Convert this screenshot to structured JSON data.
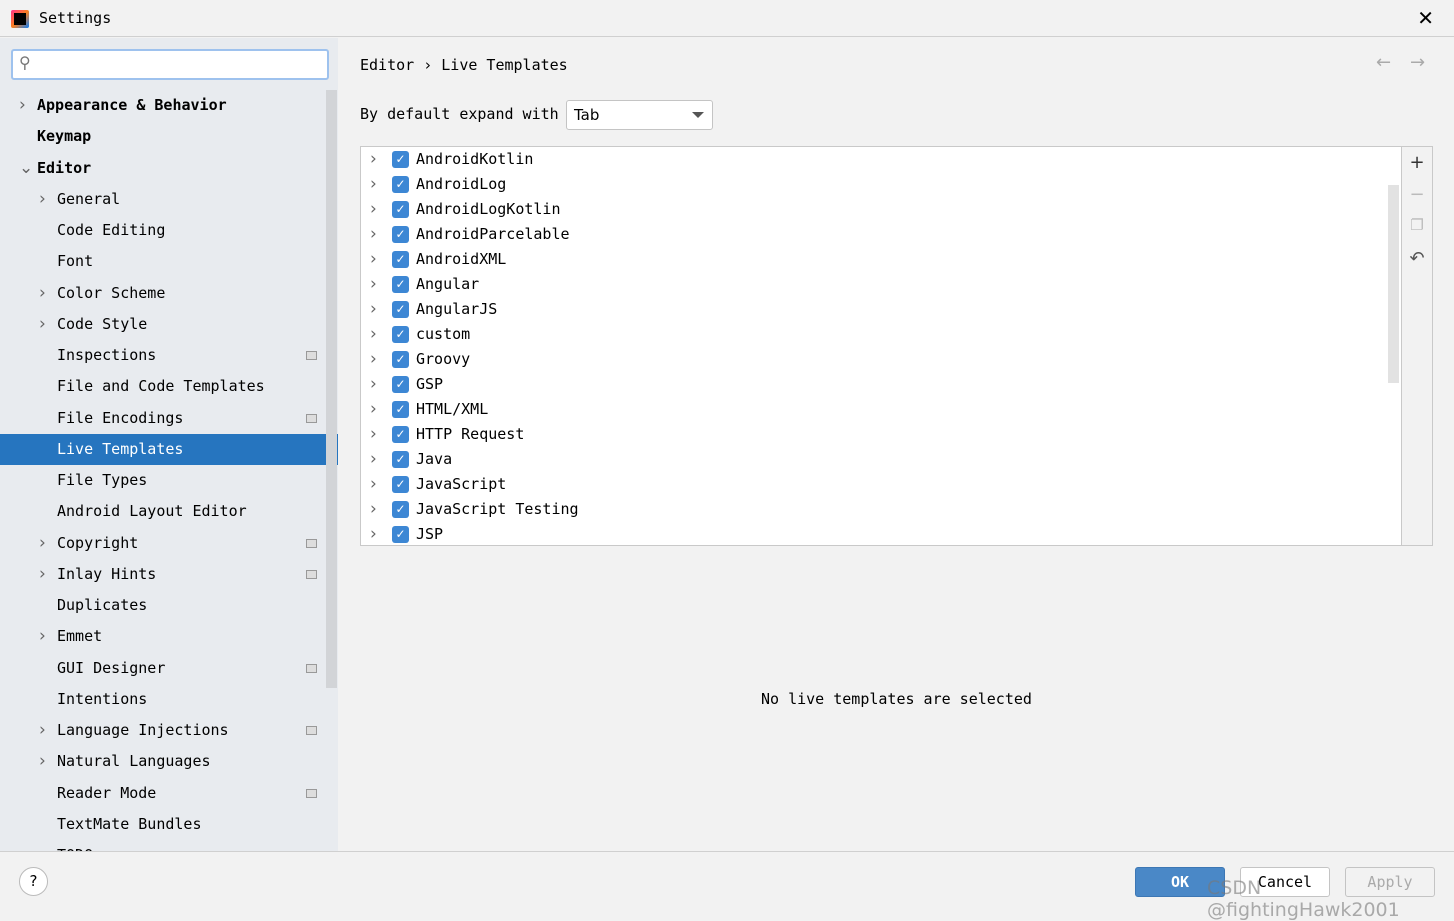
{
  "window": {
    "title": "Settings",
    "close_icon": "close-icon"
  },
  "search": {
    "placeholder": "",
    "value": ""
  },
  "sidebar": {
    "items": [
      {
        "label": "Appearance & Behavior",
        "level": 0,
        "chevron": "right",
        "bold": true
      },
      {
        "label": "Keymap",
        "level": 0,
        "bold": true
      },
      {
        "label": "Editor",
        "level": 0,
        "chevron": "down",
        "bold": true
      },
      {
        "label": "General",
        "level": 1,
        "chevron": "right"
      },
      {
        "label": "Code Editing",
        "level": 1
      },
      {
        "label": "Font",
        "level": 1
      },
      {
        "label": "Color Scheme",
        "level": 1,
        "chevron": "right"
      },
      {
        "label": "Code Style",
        "level": 1,
        "chevron": "right"
      },
      {
        "label": "Inspections",
        "level": 1,
        "badge": true
      },
      {
        "label": "File and Code Templates",
        "level": 1
      },
      {
        "label": "File Encodings",
        "level": 1,
        "badge": true
      },
      {
        "label": "Live Templates",
        "level": 1,
        "selected": true
      },
      {
        "label": "File Types",
        "level": 1
      },
      {
        "label": "Android Layout Editor",
        "level": 1
      },
      {
        "label": "Copyright",
        "level": 1,
        "chevron": "right",
        "badge": true
      },
      {
        "label": "Inlay Hints",
        "level": 1,
        "chevron": "right",
        "badge": true
      },
      {
        "label": "Duplicates",
        "level": 1
      },
      {
        "label": "Emmet",
        "level": 1,
        "chevron": "right"
      },
      {
        "label": "GUI Designer",
        "level": 1,
        "badge": true
      },
      {
        "label": "Intentions",
        "level": 1
      },
      {
        "label": "Language Injections",
        "level": 1,
        "chevron": "right",
        "badge": true
      },
      {
        "label": "Natural Languages",
        "level": 1,
        "chevron": "right"
      },
      {
        "label": "Reader Mode",
        "level": 1,
        "badge": true
      },
      {
        "label": "TextMate Bundles",
        "level": 1
      },
      {
        "label": "TODO",
        "level": 1
      }
    ]
  },
  "breadcrumb": {
    "parent": "Editor",
    "separator": "›",
    "current": "Live Templates"
  },
  "expand": {
    "label": "By default expand with",
    "value": "Tab"
  },
  "templates": [
    "AndroidKotlin",
    "AndroidLog",
    "AndroidLogKotlin",
    "AndroidParcelable",
    "AndroidXML",
    "Angular",
    "AngularJS",
    "custom",
    "Groovy",
    "GSP",
    "HTML/XML",
    "HTTP Request",
    "Java",
    "JavaScript",
    "JavaScript Testing",
    "JSP"
  ],
  "empty_message": "No live templates are selected",
  "footer": {
    "ok": "OK",
    "cancel": "Cancel",
    "apply": "Apply",
    "help": "?"
  },
  "watermark": "CSDN @fightingHawk2001",
  "colors": {
    "accent": "#2675bf",
    "checkbox": "#3d87d4",
    "ok_button": "#4a88c7"
  }
}
